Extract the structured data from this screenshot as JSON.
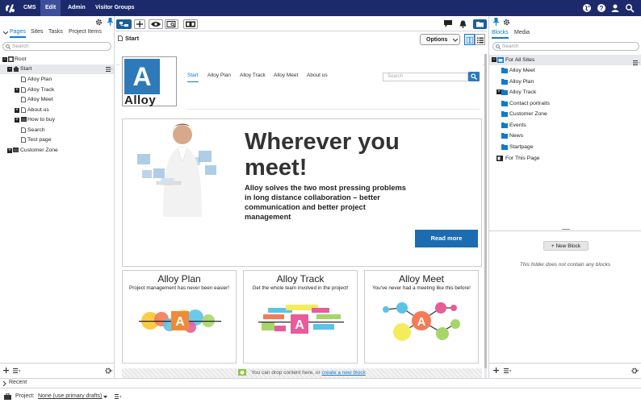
{
  "topbar": {
    "nav": [
      "CMS",
      "Edit",
      "Admin",
      "Visitor Groups"
    ]
  },
  "left_pane": {
    "tabs": [
      "Pages",
      "Sites",
      "Tasks",
      "Project Items"
    ],
    "search_placeholder": "Search",
    "tree": [
      {
        "label": "Root"
      },
      {
        "label": "Start"
      },
      {
        "label": "Alloy Plan"
      },
      {
        "label": "Alloy Track"
      },
      {
        "label": "Alloy Meet"
      },
      {
        "label": "About us"
      },
      {
        "label": "How to buy"
      },
      {
        "label": "Search"
      },
      {
        "label": "Test page"
      },
      {
        "label": "Customer Zone"
      }
    ],
    "recent_label": "Recent"
  },
  "center": {
    "page_title": "Start",
    "options_label": "Options"
  },
  "preview": {
    "logo_text": "Alloy",
    "logo_letter": "A",
    "nav": [
      "Start",
      "Alloy Plan",
      "Alloy Track",
      "Alloy Meet",
      "About us"
    ],
    "search_placeholder": "Search",
    "hero_title_line1": "Wherever you",
    "hero_title_line2": "meet!",
    "hero_body_line1": "Alloy solves the two most pressing problems",
    "hero_body_line2": "in long distance collaboration – better",
    "hero_body_line3": "communication and better project",
    "hero_body_line4": "management",
    "read_more": "Read more",
    "cards": [
      {
        "title": "Alloy Plan",
        "subtitle": "Project management has never been easier!"
      },
      {
        "title": "Alloy Track",
        "subtitle": "Get the whole team involved in the project!"
      },
      {
        "title": "Alloy Meet",
        "subtitle": "You've never had a meeting like this before!"
      }
    ],
    "dropzone_text": "You can drop content here, or",
    "dropzone_link": "create a new block"
  },
  "right_pane": {
    "tabs": [
      "Blocks",
      "Media"
    ],
    "search_placeholder": "Search",
    "folders": [
      "For All Sites",
      "Alloy Meet",
      "Alloy Plan",
      "Alloy Track",
      "Contact portraits",
      "Customer Zone",
      "Events",
      "News",
      "Startpage",
      "For This Page"
    ],
    "new_block": "+ New Block",
    "empty_message": "This folder does not contain any blocks"
  },
  "project_bar": {
    "label": "Project:",
    "value": "None (use primary drafts)"
  },
  "colors": {
    "topbar": "#1c2a6b",
    "accent": "#0f7ad0",
    "alloy_blue": "#2e7ab8",
    "read_more_btn": "#1b6cb0"
  }
}
